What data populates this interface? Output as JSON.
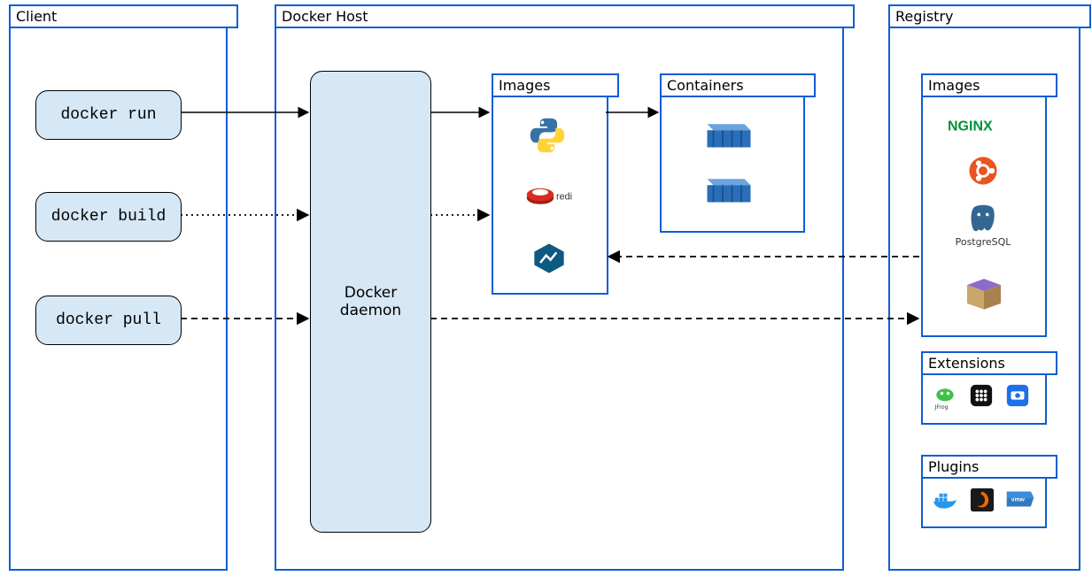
{
  "panels": {
    "client": {
      "title": "Client"
    },
    "host": {
      "title": "Docker Host"
    },
    "registry": {
      "title": "Registry"
    }
  },
  "client": {
    "cmd_run": "docker run",
    "cmd_build": "docker build",
    "cmd_pull": "docker pull"
  },
  "host": {
    "daemon_label": "Docker\ndaemon",
    "images_title": "Images",
    "images": [
      "python",
      "redis",
      "alpine"
    ],
    "containers_title": "Containers",
    "containers_count": 2
  },
  "registry": {
    "images_title": "Images",
    "images": [
      "NGINX",
      "ubuntu",
      "PostgreSQL",
      "box"
    ],
    "extensions_title": "Extensions",
    "extensions": [
      "JFrog",
      "portainer",
      "lens"
    ],
    "plugins_title": "Plugins",
    "plugins": [
      "docker",
      "grafana",
      "vmw"
    ]
  },
  "arrows": [
    {
      "id": "run-to-daemon",
      "style": "solid",
      "from": "client.cmd_run",
      "to": "host.daemon"
    },
    {
      "id": "build-to-daemon",
      "style": "dotted",
      "from": "client.cmd_build",
      "to": "host.daemon"
    },
    {
      "id": "pull-to-daemon",
      "style": "dashed",
      "from": "client.cmd_pull",
      "to": "host.daemon"
    },
    {
      "id": "daemon-to-images-run",
      "style": "solid",
      "from": "host.daemon",
      "to": "host.images"
    },
    {
      "id": "daemon-to-images-build",
      "style": "dotted",
      "from": "host.daemon",
      "to": "host.images"
    },
    {
      "id": "images-to-containers",
      "style": "solid",
      "from": "host.images",
      "to": "host.containers"
    },
    {
      "id": "registry-to-hostimages",
      "style": "dashed",
      "from": "registry.images",
      "to": "host.images"
    },
    {
      "id": "daemon-to-registry",
      "style": "dashed",
      "from": "host.daemon",
      "to": "registry.images"
    }
  ]
}
